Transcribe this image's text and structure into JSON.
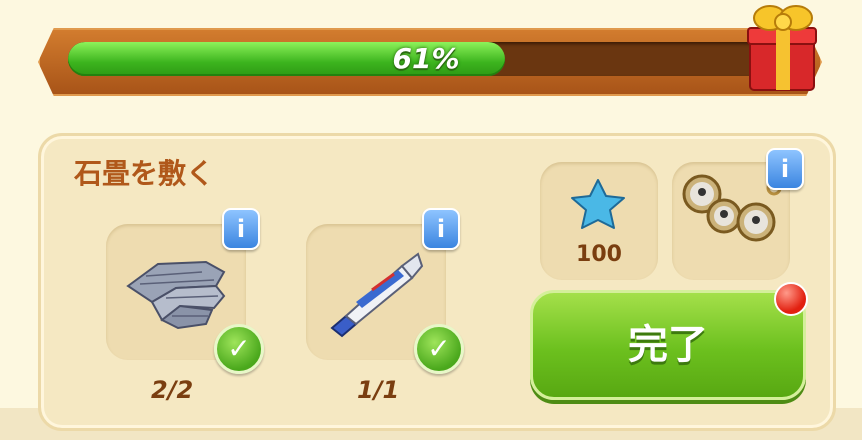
{
  "progress": {
    "label": "61%",
    "value": 0.61
  },
  "task": {
    "title": "石畳を敷く"
  },
  "items": [
    {
      "icon": "cobblestone-icon",
      "count": "2/2",
      "done": true
    },
    {
      "icon": "glue-tube-icon",
      "count": "1/1",
      "done": true
    }
  ],
  "rewards": {
    "star_amount": "100",
    "star_icon": "blue-star-icon",
    "locket_icon": "locket-icon"
  },
  "info_glyph": "i",
  "check_glyph": "✓",
  "complete_button": {
    "label": "完了"
  }
}
